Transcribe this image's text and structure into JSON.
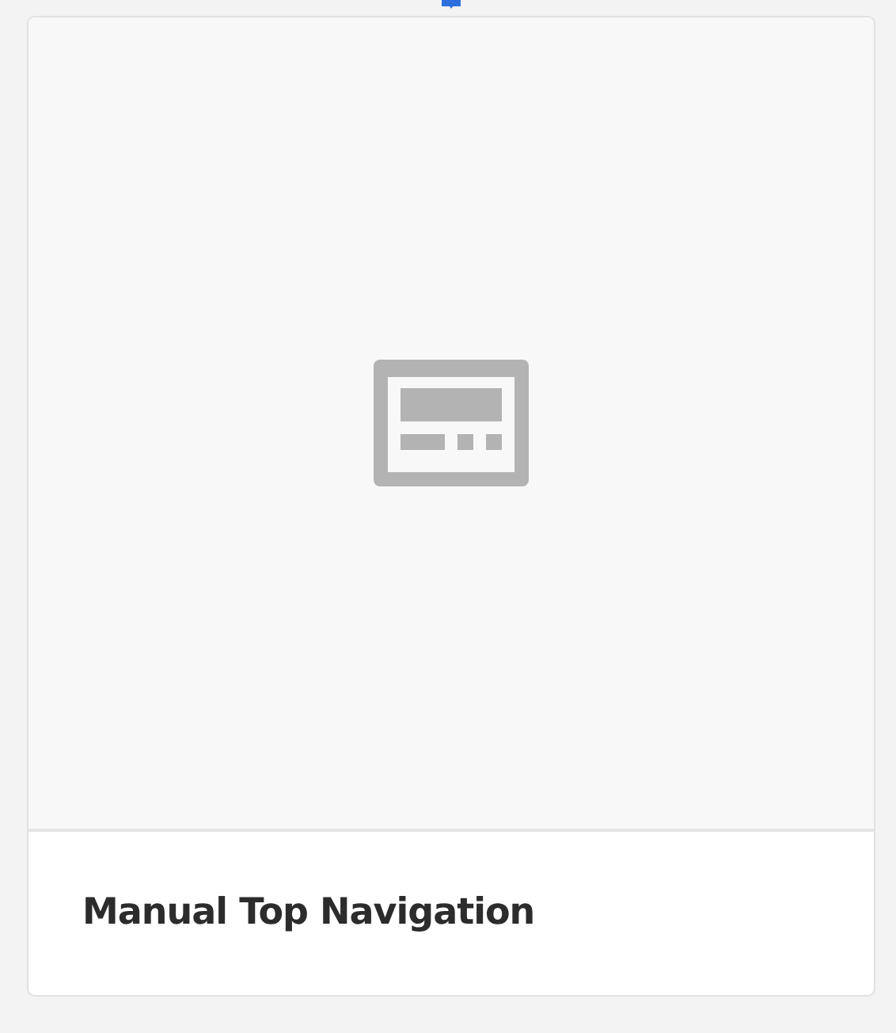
{
  "card": {
    "title": "Manual Top Navigation"
  }
}
